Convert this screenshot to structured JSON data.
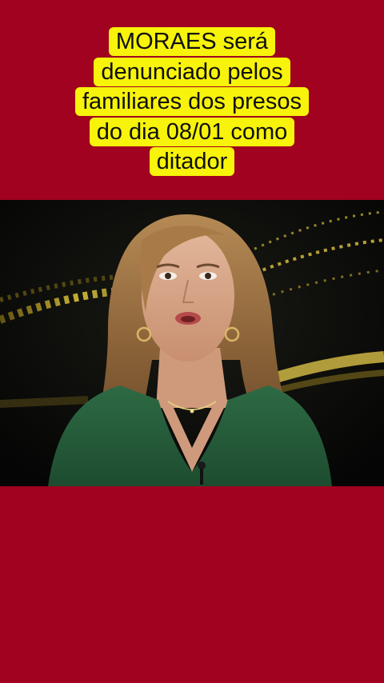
{
  "caption": {
    "lines": [
      "MORAES será",
      "denunciado pelos",
      "familiares dos presos",
      "do dia 08/01 como",
      "ditador"
    ]
  },
  "video": {
    "description_icon": "news-anchor-video-frame"
  },
  "colors": {
    "background": "#a0021f",
    "caption_highlight": "#f7f30a",
    "caption_text": "#101010"
  }
}
